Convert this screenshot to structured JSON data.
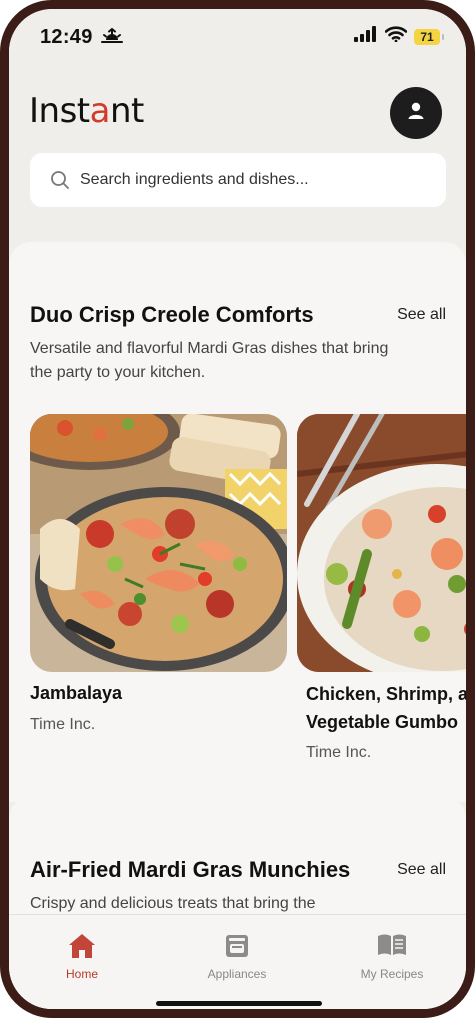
{
  "status": {
    "time": "12:49",
    "battery": "71"
  },
  "header": {
    "logo": "Instant"
  },
  "search": {
    "placeholder": "Search ingredients and dishes..."
  },
  "sections": [
    {
      "title": "Duo Crisp Creole Comforts",
      "see_all": "See all",
      "description": "Versatile and flavorful Mardi Gras dishes that bring the party to your kitchen.",
      "cards": [
        {
          "title": "Jambalaya",
          "source": "Time Inc."
        },
        {
          "title_line1": "Chicken, Shrimp, a",
          "title_line2": "Vegetable Gumbo",
          "source": "Time Inc."
        }
      ]
    },
    {
      "title": "Air-Fried Mardi Gras Munchies",
      "see_all": "See all",
      "description": "Crispy and delicious treats that bring the"
    }
  ],
  "tabs": [
    {
      "label": "Home",
      "icon": "home-icon",
      "active": true
    },
    {
      "label": "Appliances",
      "icon": "appliance-icon",
      "active": false
    },
    {
      "label": "My Recipes",
      "icon": "book-icon",
      "active": false
    }
  ],
  "colors": {
    "accent": "#b83a2b",
    "frame": "#3b1c17",
    "battery": "#f5d442"
  }
}
